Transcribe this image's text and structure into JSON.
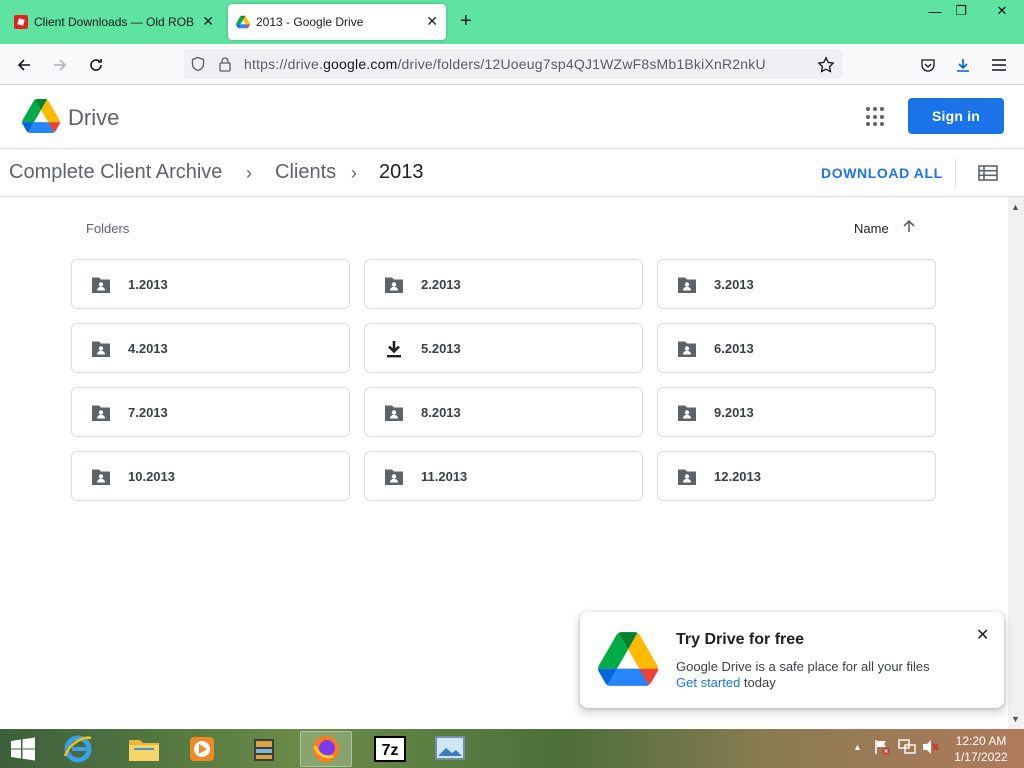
{
  "browser": {
    "tabs": [
      {
        "title": "Client Downloads — Old ROBLOX",
        "active": false
      },
      {
        "title": "2013 - Google Drive",
        "active": true
      }
    ],
    "new_tab": "+",
    "window_controls": {
      "minimize": "—",
      "maximize": "❐",
      "close": "✕"
    },
    "url": {
      "prefix": "https://drive.",
      "host": "google.com",
      "path": "/drive/folders/12Uoeug7sp4QJ1WZwF8sMb1BkiXnR2nkU"
    }
  },
  "header": {
    "app_name": "Drive",
    "sign_in": "Sign in"
  },
  "breadcrumb": {
    "items": [
      "Complete Client Archive",
      "Clients",
      "2013"
    ],
    "separator": "›",
    "download_all": "DOWNLOAD ALL"
  },
  "content": {
    "section_label": "Folders",
    "sort_label": "Name",
    "folders": [
      {
        "name": "1.2013",
        "icon": "shared-folder-icon"
      },
      {
        "name": "2.2013",
        "icon": "shared-folder-icon"
      },
      {
        "name": "3.2013",
        "icon": "shared-folder-icon"
      },
      {
        "name": "4.2013",
        "icon": "shared-folder-icon"
      },
      {
        "name": "5.2013",
        "icon": "download-icon"
      },
      {
        "name": "6.2013",
        "icon": "shared-folder-icon"
      },
      {
        "name": "7.2013",
        "icon": "shared-folder-icon"
      },
      {
        "name": "8.2013",
        "icon": "shared-folder-icon"
      },
      {
        "name": "9.2013",
        "icon": "shared-folder-icon"
      },
      {
        "name": "10.2013",
        "icon": "shared-folder-icon"
      },
      {
        "name": "11.2013",
        "icon": "shared-folder-icon"
      },
      {
        "name": "12.2013",
        "icon": "shared-folder-icon"
      }
    ]
  },
  "promo": {
    "title": "Try Drive for free",
    "line1": "Google Drive is a safe place for all your files",
    "link": "Get started",
    "line2_rest": " today",
    "close": "✕"
  },
  "taskbar": {
    "time": "12:20 AM",
    "date": "1/17/2022",
    "tray_up": "▲"
  },
  "colors": {
    "tabbar": "#5fe3a3",
    "accent": "#1a73e8"
  }
}
